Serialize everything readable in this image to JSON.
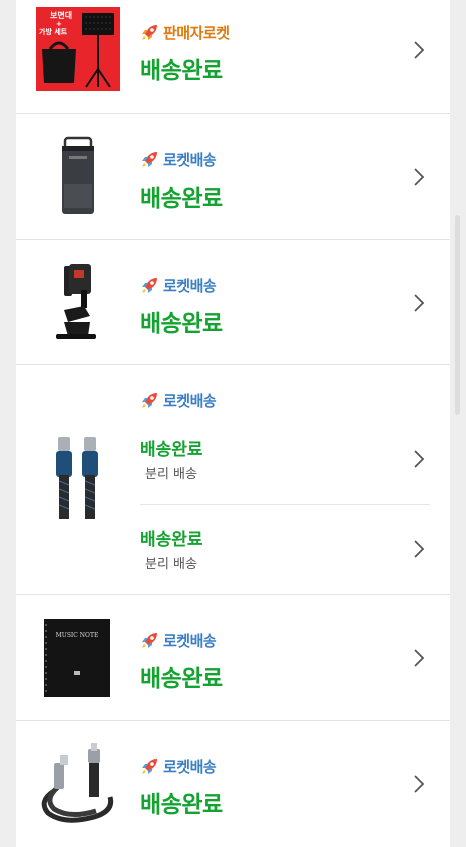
{
  "orders": [
    {
      "thumb_icon": "music-stand-set-image",
      "thumb_text_line1": "보면대",
      "thumb_text_line2": "+",
      "thumb_text_line3": "가방 세트",
      "badge_type": "seller-rocket",
      "badge_icon": "rocket-icon",
      "badge_label": "판매자로켓",
      "status": "배송완료"
    },
    {
      "thumb_icon": "power-bank-image",
      "badge_type": "rocket",
      "badge_icon": "rocket-icon",
      "badge_label": "로켓배송",
      "status": "배송완료"
    },
    {
      "thumb_icon": "phone-clamp-holder-image",
      "badge_type": "rocket",
      "badge_icon": "rocket-icon",
      "badge_label": "로켓배송",
      "status": "배송완료"
    },
    {
      "thumb_icon": "usb-c-cable-image",
      "badge_type": "rocket",
      "badge_icon": "rocket-icon",
      "badge_label": "로켓배송",
      "shipments": [
        {
          "status": "배송완료",
          "note": "분리 배송"
        },
        {
          "status": "배송완료",
          "note": "분리 배송"
        }
      ]
    },
    {
      "thumb_icon": "music-notebook-image",
      "thumb_text": "MUSIC NOTE",
      "badge_type": "rocket",
      "badge_icon": "rocket-icon",
      "badge_label": "로켓배송",
      "status": "배송완료"
    },
    {
      "thumb_icon": "angled-usb-c-cable-image",
      "badge_type": "rocket",
      "badge_icon": "rocket-icon",
      "badge_label": "로켓배송",
      "status": "배송완료"
    }
  ],
  "colors": {
    "status_green": "#14a331",
    "rocket_blue": "#3a7fc4",
    "seller_orange": "#e07a0f"
  },
  "chevron_icon": "chevron-right-icon"
}
